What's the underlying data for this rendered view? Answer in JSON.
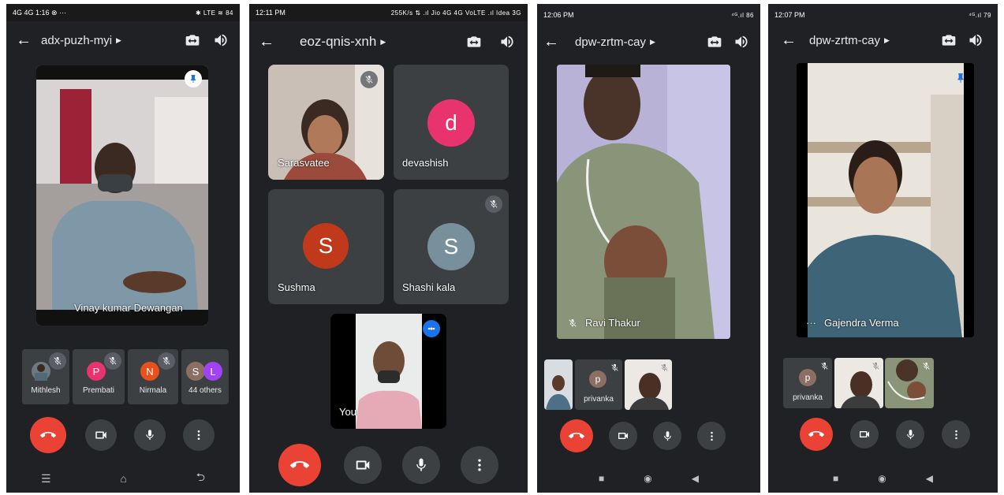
{
  "panel1": {
    "status_left": "4G 4G 1:16 ⊗ ···",
    "status_right": "✱ LTE ≋ 84",
    "meeting_code": "adx-puzh-myi",
    "main_participant": "Vinay kumar Dewangan",
    "strip": [
      {
        "name": "Mithlesh",
        "initial": ""
      },
      {
        "name": "Prembati",
        "initial": "P"
      },
      {
        "name": "Nirmala",
        "initial": "N"
      },
      {
        "name": "44 others",
        "initial_a": "S",
        "initial_b": "L"
      }
    ]
  },
  "panel2": {
    "status_time": "12:11 PM",
    "status_right": "255K/s ⇅ .ıl Jio 4G 4G VoLTE .ıl Idea 3G",
    "meeting_code": "eoz-qnis-xnh",
    "tiles": [
      {
        "name": "Sarasvatee"
      },
      {
        "name": "devashish",
        "initial": "d"
      },
      {
        "name": "Sushma",
        "initial": "S"
      },
      {
        "name": "Shashi kala",
        "initial": "S"
      }
    ],
    "self_label": "You"
  },
  "panel3": {
    "status_time": "12:06 PM",
    "status_right": "⁴ᴳ.ıl 86",
    "meeting_code": "dpw-zrtm-cay",
    "main_participant": "Ravi Thakur",
    "strip_name": "privanka",
    "strip_initial": "p"
  },
  "panel4": {
    "status_time": "12:07 PM",
    "status_right": "⁴ᴳ.ıl 79",
    "meeting_code": "dpw-zrtm-cay",
    "main_participant": "Gajendra Verma",
    "more_dots": "···",
    "strip_name": "privanka",
    "strip_initial": "p"
  },
  "colors": {
    "background": "#202124",
    "tile": "#3c4043",
    "end_call": "#ea4335",
    "avatar_pink": "#e8336e",
    "avatar_orange": "#e8501c",
    "avatar_red": "#c1391b",
    "avatar_slate": "#78909c",
    "avatar_purple": "#a142f4",
    "avatar_brown": "#8d6e63",
    "accent_blue": "#1a73e8"
  }
}
